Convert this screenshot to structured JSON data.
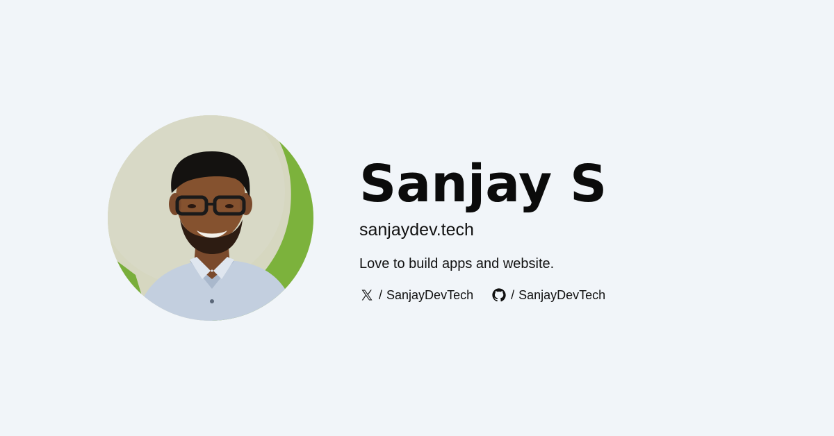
{
  "profile": {
    "name": "Sanjay S",
    "website": "sanjaydev.tech",
    "tagline": "Love to build apps and website.",
    "avatar_icon": "profile-photo"
  },
  "socials": [
    {
      "icon": "x-icon",
      "separator": "/",
      "handle": "SanjayDevTech"
    },
    {
      "icon": "github-icon",
      "separator": "/",
      "handle": "SanjayDevTech"
    }
  ],
  "colors": {
    "background": "#f1f5f9",
    "text": "#0b0b0b",
    "avatar_green": "#7db43f",
    "avatar_wall": "#d9dbc4"
  }
}
